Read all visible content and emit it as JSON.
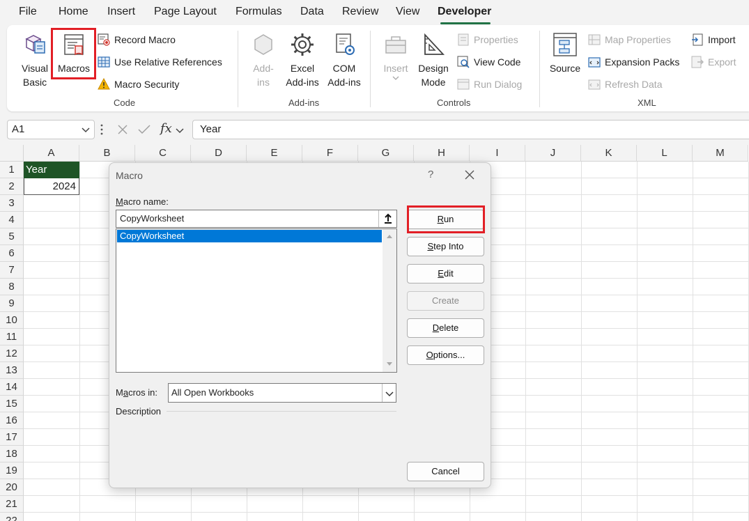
{
  "menu": {
    "tabs": [
      "File",
      "Home",
      "Insert",
      "Page Layout",
      "Formulas",
      "Data",
      "Review",
      "View",
      "Developer"
    ],
    "active_tab": "Developer"
  },
  "ribbon": {
    "code": {
      "label": "Code",
      "visual_basic": "Visual\nBasic",
      "macros": "Macros",
      "record_macro": "Record Macro",
      "use_relative_references": "Use Relative References",
      "macro_security": "Macro Security"
    },
    "addins": {
      "label": "Add-ins",
      "add_ins": "Add-\nins",
      "excel_add_ins": "Excel\nAdd-ins",
      "com_add_ins": "COM\nAdd-ins"
    },
    "controls": {
      "label": "Controls",
      "insert": "Insert",
      "design_mode": "Design\nMode",
      "properties": "Properties",
      "view_code": "View Code",
      "run_dialog": "Run Dialog"
    },
    "xml": {
      "label": "XML",
      "source": "Source",
      "map_properties": "Map Properties",
      "expansion_packs": "Expansion Packs",
      "refresh_data": "Refresh Data",
      "import": "Import",
      "export": "Export"
    }
  },
  "formula_bar": {
    "name_box": "A1",
    "fx": "fx",
    "value": "Year"
  },
  "sheet": {
    "columns": [
      "A",
      "B",
      "C",
      "D",
      "E",
      "F",
      "G",
      "H",
      "I",
      "J",
      "K",
      "L",
      "M"
    ],
    "rows": [
      "1",
      "2",
      "3",
      "4",
      "5",
      "6",
      "7",
      "8",
      "9",
      "10",
      "11",
      "12",
      "13",
      "14",
      "15",
      "16",
      "17",
      "18",
      "19",
      "20",
      "21",
      "22"
    ],
    "cells": {
      "A1": "Year",
      "A2": "2024"
    }
  },
  "dialog": {
    "title": "Macro",
    "help": "?",
    "macro_name_label_first": "M",
    "macro_name_label_rest": "acro name:",
    "macro_name_value": "CopyWorksheet",
    "macro_list": [
      "CopyWorksheet"
    ],
    "buttons": {
      "run": {
        "u": "R",
        "rest": "un"
      },
      "step_into": {
        "u": "S",
        "rest": "tep Into"
      },
      "edit": {
        "u": "E",
        "rest": "dit"
      },
      "create": "Create",
      "delete": {
        "u": "D",
        "rest": "elete"
      },
      "options": {
        "u": "O",
        "rest": "ptions..."
      },
      "cancel": "Cancel"
    },
    "macros_in_label_first": "M",
    "macros_in_label_underlined": "a",
    "macros_in_label_rest": "cros in:",
    "macros_in_value": "All Open Workbooks",
    "description_label": "Description"
  },
  "colors": {
    "accent_green": "#217346",
    "header_fill": "#1e5426",
    "highlight_red": "#e21f26",
    "selection_blue": "#0078d7"
  }
}
